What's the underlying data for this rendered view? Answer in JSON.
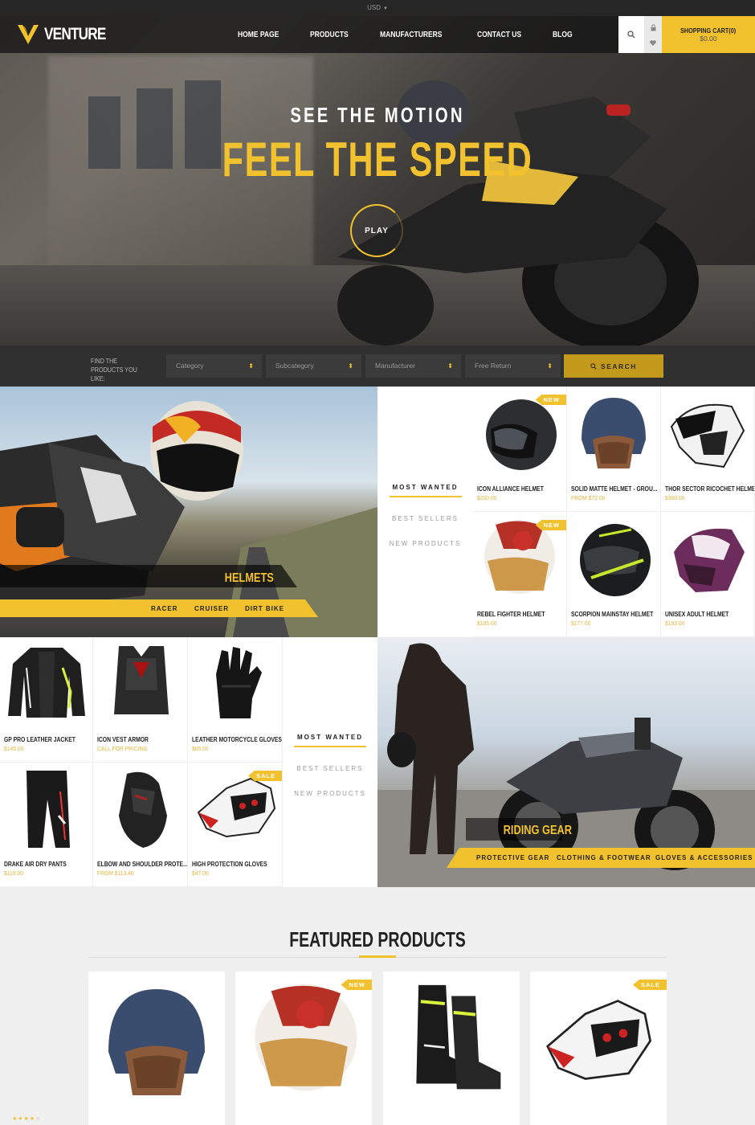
{
  "topbar": {
    "currency": "USD"
  },
  "header": {
    "logo_text": "VENTURE",
    "nav": [
      "HOME PAGE",
      "PRODUCTS",
      "MANUFACTURERS",
      "CONTACT US",
      "BLOG"
    ],
    "cart_label": "SHOPPING CART(0)",
    "cart_total": "$0.00"
  },
  "hero": {
    "line1": "SEE THE MOTION",
    "line2": "FEEL THE SPEED",
    "play": "PLAY"
  },
  "search": {
    "label": "FIND THE PRODUCTS YOU LIKE:",
    "selects": [
      "Category",
      "Subcategory",
      "Manufacturer",
      "Free Return"
    ],
    "button": "SEARCH"
  },
  "helmets_section": {
    "title": "HELMETS",
    "subcategories": [
      "RACER",
      "CRUISER",
      "DIRT BIKE"
    ],
    "tabs": [
      "MOST WANTED",
      "BEST SELLERS",
      "NEW PRODUCTS"
    ],
    "products": [
      {
        "name": "ICON ALLIANCE HELMET",
        "price": "$200.00",
        "badge": "NEW"
      },
      {
        "name": "SOLID MATTE HELMET - GROU...",
        "price": "FROM $72.00",
        "badge": ""
      },
      {
        "name": "THOR SECTOR RICOCHET HELMET",
        "price": "$360.00",
        "badge": ""
      },
      {
        "name": "REBEL FIGHTER HELMET",
        "price": "$185.00",
        "badge": "NEW"
      },
      {
        "name": "SCORPION MAINSTAY HELMET",
        "price": "$177.00",
        "badge": ""
      },
      {
        "name": "UNISEX ADULT HELMET",
        "price": "$193.00",
        "badge": ""
      }
    ]
  },
  "gear_section": {
    "title": "RIDING GEAR",
    "subcategories": [
      "PROTECTIVE GEAR",
      "CLOTHING & FOOTWEAR",
      "GLOVES & ACCESSORIES"
    ],
    "tabs": [
      "MOST WANTED",
      "BEST SELLERS",
      "NEW PRODUCTS"
    ],
    "products": [
      {
        "name": "GP PRO LEATHER JACKET",
        "price": "$145.00",
        "badge": ""
      },
      {
        "name": "ICON VEST ARMOR",
        "price": "CALL FOR PRICING",
        "badge": ""
      },
      {
        "name": "LEATHER MOTORCYCLE GLOVES",
        "price": "$65.00",
        "badge": ""
      },
      {
        "name": "DRAKE AIR DRY PANTS",
        "price": "$119.00",
        "badge": ""
      },
      {
        "name": "ELBOW AND SHOULDER PROTE...",
        "price": "FROM $113.40",
        "badge": ""
      },
      {
        "name": "HIGH PROTECTION GLOVES",
        "price": "$47.00",
        "badge": "SALE"
      }
    ]
  },
  "featured": {
    "title": "FEATURED PRODUCTS",
    "badges": [
      "",
      "NEW",
      "",
      "SALE"
    ],
    "rating": 4
  },
  "colors": {
    "accent": "#f2c12e",
    "dark": "#262626",
    "price": "#e1b33a"
  }
}
